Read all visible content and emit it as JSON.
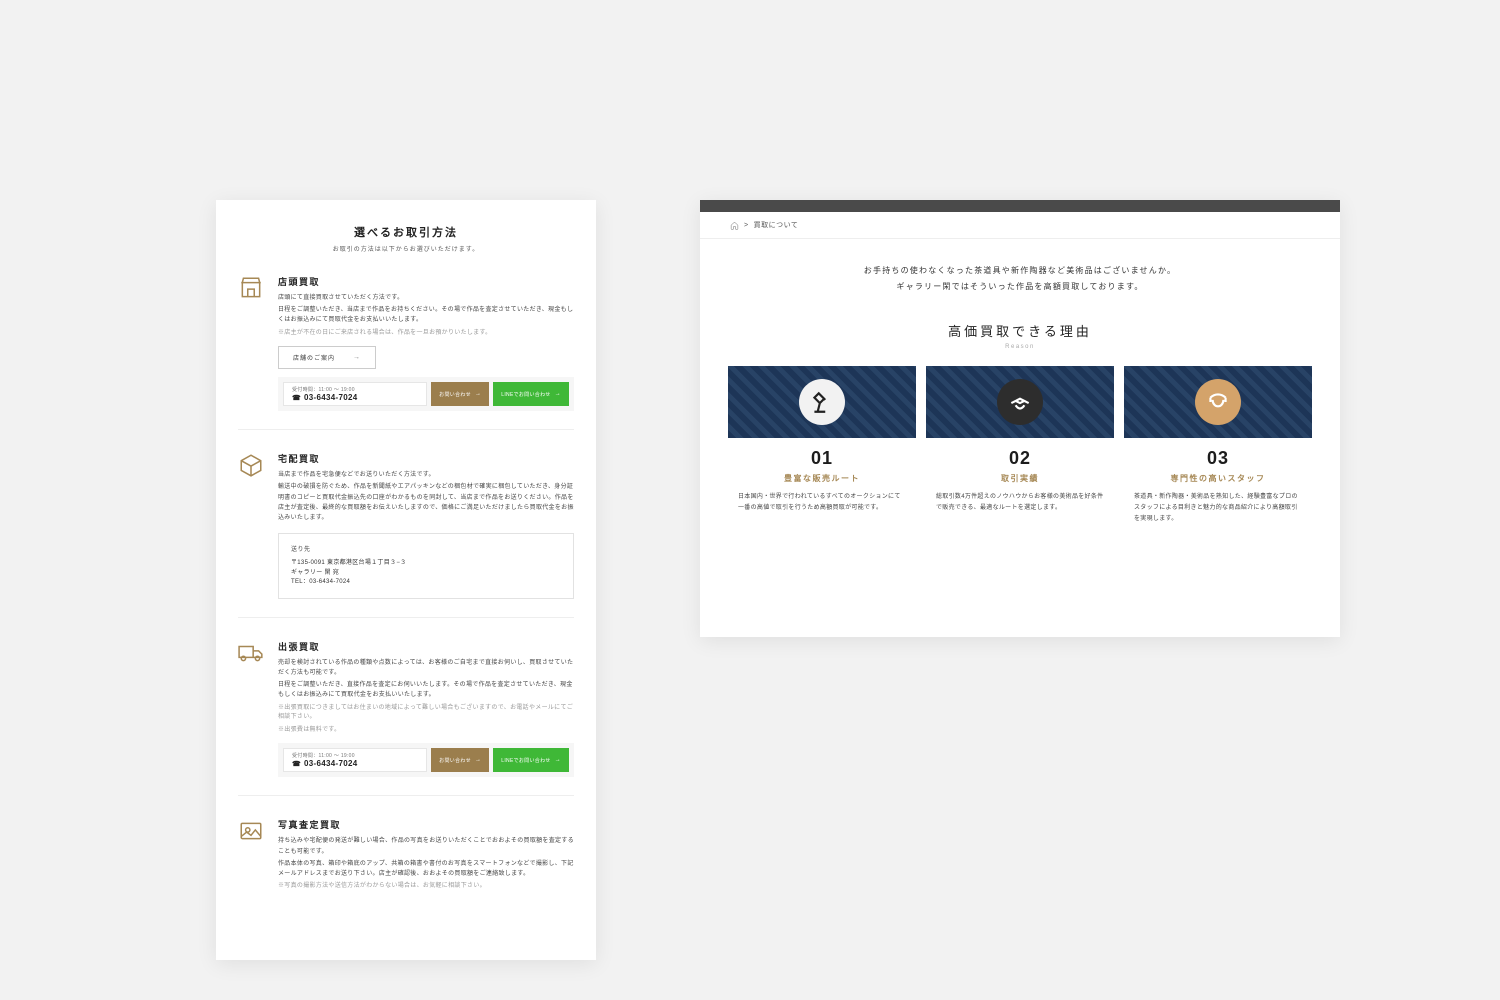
{
  "left": {
    "title": "選べるお取引方法",
    "subtitle": "お取引の方法は以下からお選びいただけます。",
    "methods": [
      {
        "icon": "store-icon",
        "heading": "店頭買取",
        "lines": [
          "店頭にて直接買取させていただく方法です。",
          "日程をご調整いただき、当店まで作品をお持ちください。その場で作品を査定させていただき、現金もしくはお振込みにて買取代金をお支払いいたします。"
        ],
        "notes": [
          "※店主が不在の日にご来店される場合は、作品を一旦お預かりいたします。"
        ],
        "outline_btn": "店舗のご案内",
        "contact": true
      },
      {
        "icon": "box-icon",
        "heading": "宅配買取",
        "lines": [
          "当店まで作品を宅急便などでお送りいただく方法です。",
          "輸送中の破損を防ぐため、作品を新聞紙やエアパッキンなどの梱包材で確実に梱包していただき、身分証明書のコピーと買取代金振込先の口座がわかるものを同封して、当店まで作品をお送りください。作品を店主が査定後、最終的な買取額をお伝えいたしますので、価格にご満足いただけましたら買取代金をお振込みいたします。"
        ],
        "addr": {
          "label": "送り先",
          "lines": [
            "〒135-0091 東京都港区台場１丁目３−３",
            "ギャラリー 閑 宛",
            "TEL：03-6434-7024"
          ]
        }
      },
      {
        "icon": "truck-icon",
        "heading": "出張買取",
        "lines": [
          "売却を検討されている作品の種類や点数によっては、お客様のご自宅まで直接お伺いし、買取させていただく方法も可能です。",
          "日程をご調整いただき、直接作品を査定にお伺いいたします。その場で作品を査定させていただき、現金もしくはお振込みにて買取代金をお支払いいたします。"
        ],
        "notes": [
          "※出張買取につきましてはお住まいの地域によって難しい場合もございますので、お電話やメールにてご相談下さい。",
          "※出張費は無料です。"
        ],
        "contact": true
      },
      {
        "icon": "photo-icon",
        "heading": "写真査定買取",
        "lines": [
          "持ち込みや宅配便の発送が難しい場合、作品の写真をお送りいただくことでおおよその買取額を査定することも可能です。",
          "作品本体の写真、箱印や箱底のアップ、共箱の箱書や書付のお写真をスマートフォンなどで撮影し、下記メールアドレスまでお送り下さい。店主が確認後、おおよその買取額をご連絡致します。"
        ],
        "notes": [
          "※写真の撮影方法や送信方法がわからない場合は、お気軽に相談下さい。"
        ]
      }
    ],
    "contact": {
      "hours": "受付時間：11:00 〜 19:00",
      "phone": "03-6434-7024",
      "btn_brown": "お問い合わせ",
      "btn_green": "LINEでお問い合わせ"
    }
  },
  "right": {
    "breadcrumb": "買取について",
    "intro1": "お手持ちの使わなくなった茶道具や新作陶器など美術品はございませんか。",
    "intro2": "ギャラリー閑ではそういった作品を高額買取しております。",
    "sec_title": "高価買取できる理由",
    "sec_sub": "Reason",
    "cards": [
      {
        "num": "01",
        "h": "豊富な販売ルート",
        "p": "日本国内・世界で行われているすべてのオークションにて一番の高値で取引を行うため高額買取が可能です。"
      },
      {
        "num": "02",
        "h": "取引実績",
        "p": "総取引数4万件超えのノウハウからお客様の美術品を好条件で販売できる、最適なルートを選定します。"
      },
      {
        "num": "03",
        "h": "専門性の高いスタッフ",
        "p": "茶道具・新作陶器・美術品を熟知した、経験豊富なプロのスタッフによる目利きと魅力的な商品紹介により高額取引を実現します。"
      }
    ]
  }
}
